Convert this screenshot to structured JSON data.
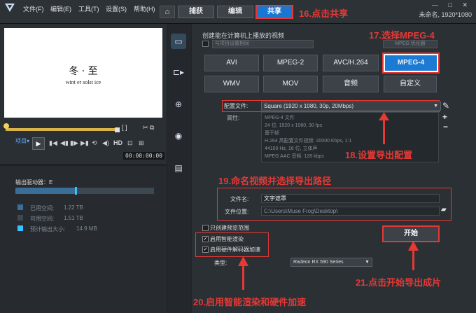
{
  "menu": {
    "file": "文件(F)",
    "edit": "编辑(E)",
    "tools": "工具(T)",
    "settings": "设置(S)",
    "help": "帮助(H)"
  },
  "window": {
    "title": "未命名, 1920*1080",
    "controls": "— □ ✕"
  },
  "tabs": {
    "capture": "捕获",
    "edit": "编辑",
    "share": "共享"
  },
  "annotations": {
    "a16": "16.点击共享",
    "a17": "17.选择MPEG-4",
    "a18": "18.设置导出配置",
    "a19": "19.命名视频并选择导出路径",
    "a20": "20.启用智能渲染和硬件加速",
    "a21": "21.点击开始导出成片"
  },
  "preview": {
    "title": "冬 · 至",
    "subtitle": "wint er solst ice",
    "project_label": "项目▾",
    "hd": "HD",
    "timecode": "00:00:00:00"
  },
  "storage": {
    "drive_label": "输出驱动器：E",
    "used_fraction": 0.43,
    "items": [
      {
        "label": "已用空间:",
        "value": "1.22 TB",
        "color": "#3b6e96"
      },
      {
        "label": "可用空间:",
        "value": "1.51 TB",
        "color": "#3d4850"
      },
      {
        "label": "预计输出大小:",
        "value": "14.9 MB",
        "color": "#3ac1ff"
      }
    ]
  },
  "side_icons": [
    "monitor-icon",
    "device-icon",
    "globe-icon",
    "disc-icon",
    "image-file-icon"
  ],
  "share": {
    "create_text": "创建能在计算机上播放的视频",
    "ref_placeholder": "与项目设置相同",
    "mpeg_option": "MPEG 优化器",
    "formats_row1": [
      "AVI",
      "MPEG-2",
      "AVC/H.264",
      "MPEG-4"
    ],
    "formats_row2": [
      "WMV",
      "MOV",
      "音频",
      "自定义"
    ],
    "selected_format": "MPEG-4",
    "config_label": "配置文件:",
    "config_value": "Square (1920 x 1080, 30p, 20Mbps)",
    "props_label": "属性:",
    "props": [
      "MPEG-4 文件",
      "24 位, 1920 x 1080, 30 fps",
      "基于帧",
      "H.264 高配置文件视频: 20000 Kbps, 1:1",
      "44100 Hz, 16 位, 立体声",
      "MPEG AAC 音频: 128 kbps"
    ],
    "filename_label": "文件名:",
    "filename_value": "文字遮罩",
    "location_label": "文件位置:",
    "location_value": "C:\\Users\\Muse Frog\\Desktop\\",
    "preview_range": "只创建预览范围",
    "smart_render": "启用智能渲染",
    "hw_accel": "启用硬件解码器加速",
    "type_label": "类型:",
    "type_value": "Radeon RX 590 Series",
    "start": "开始"
  }
}
